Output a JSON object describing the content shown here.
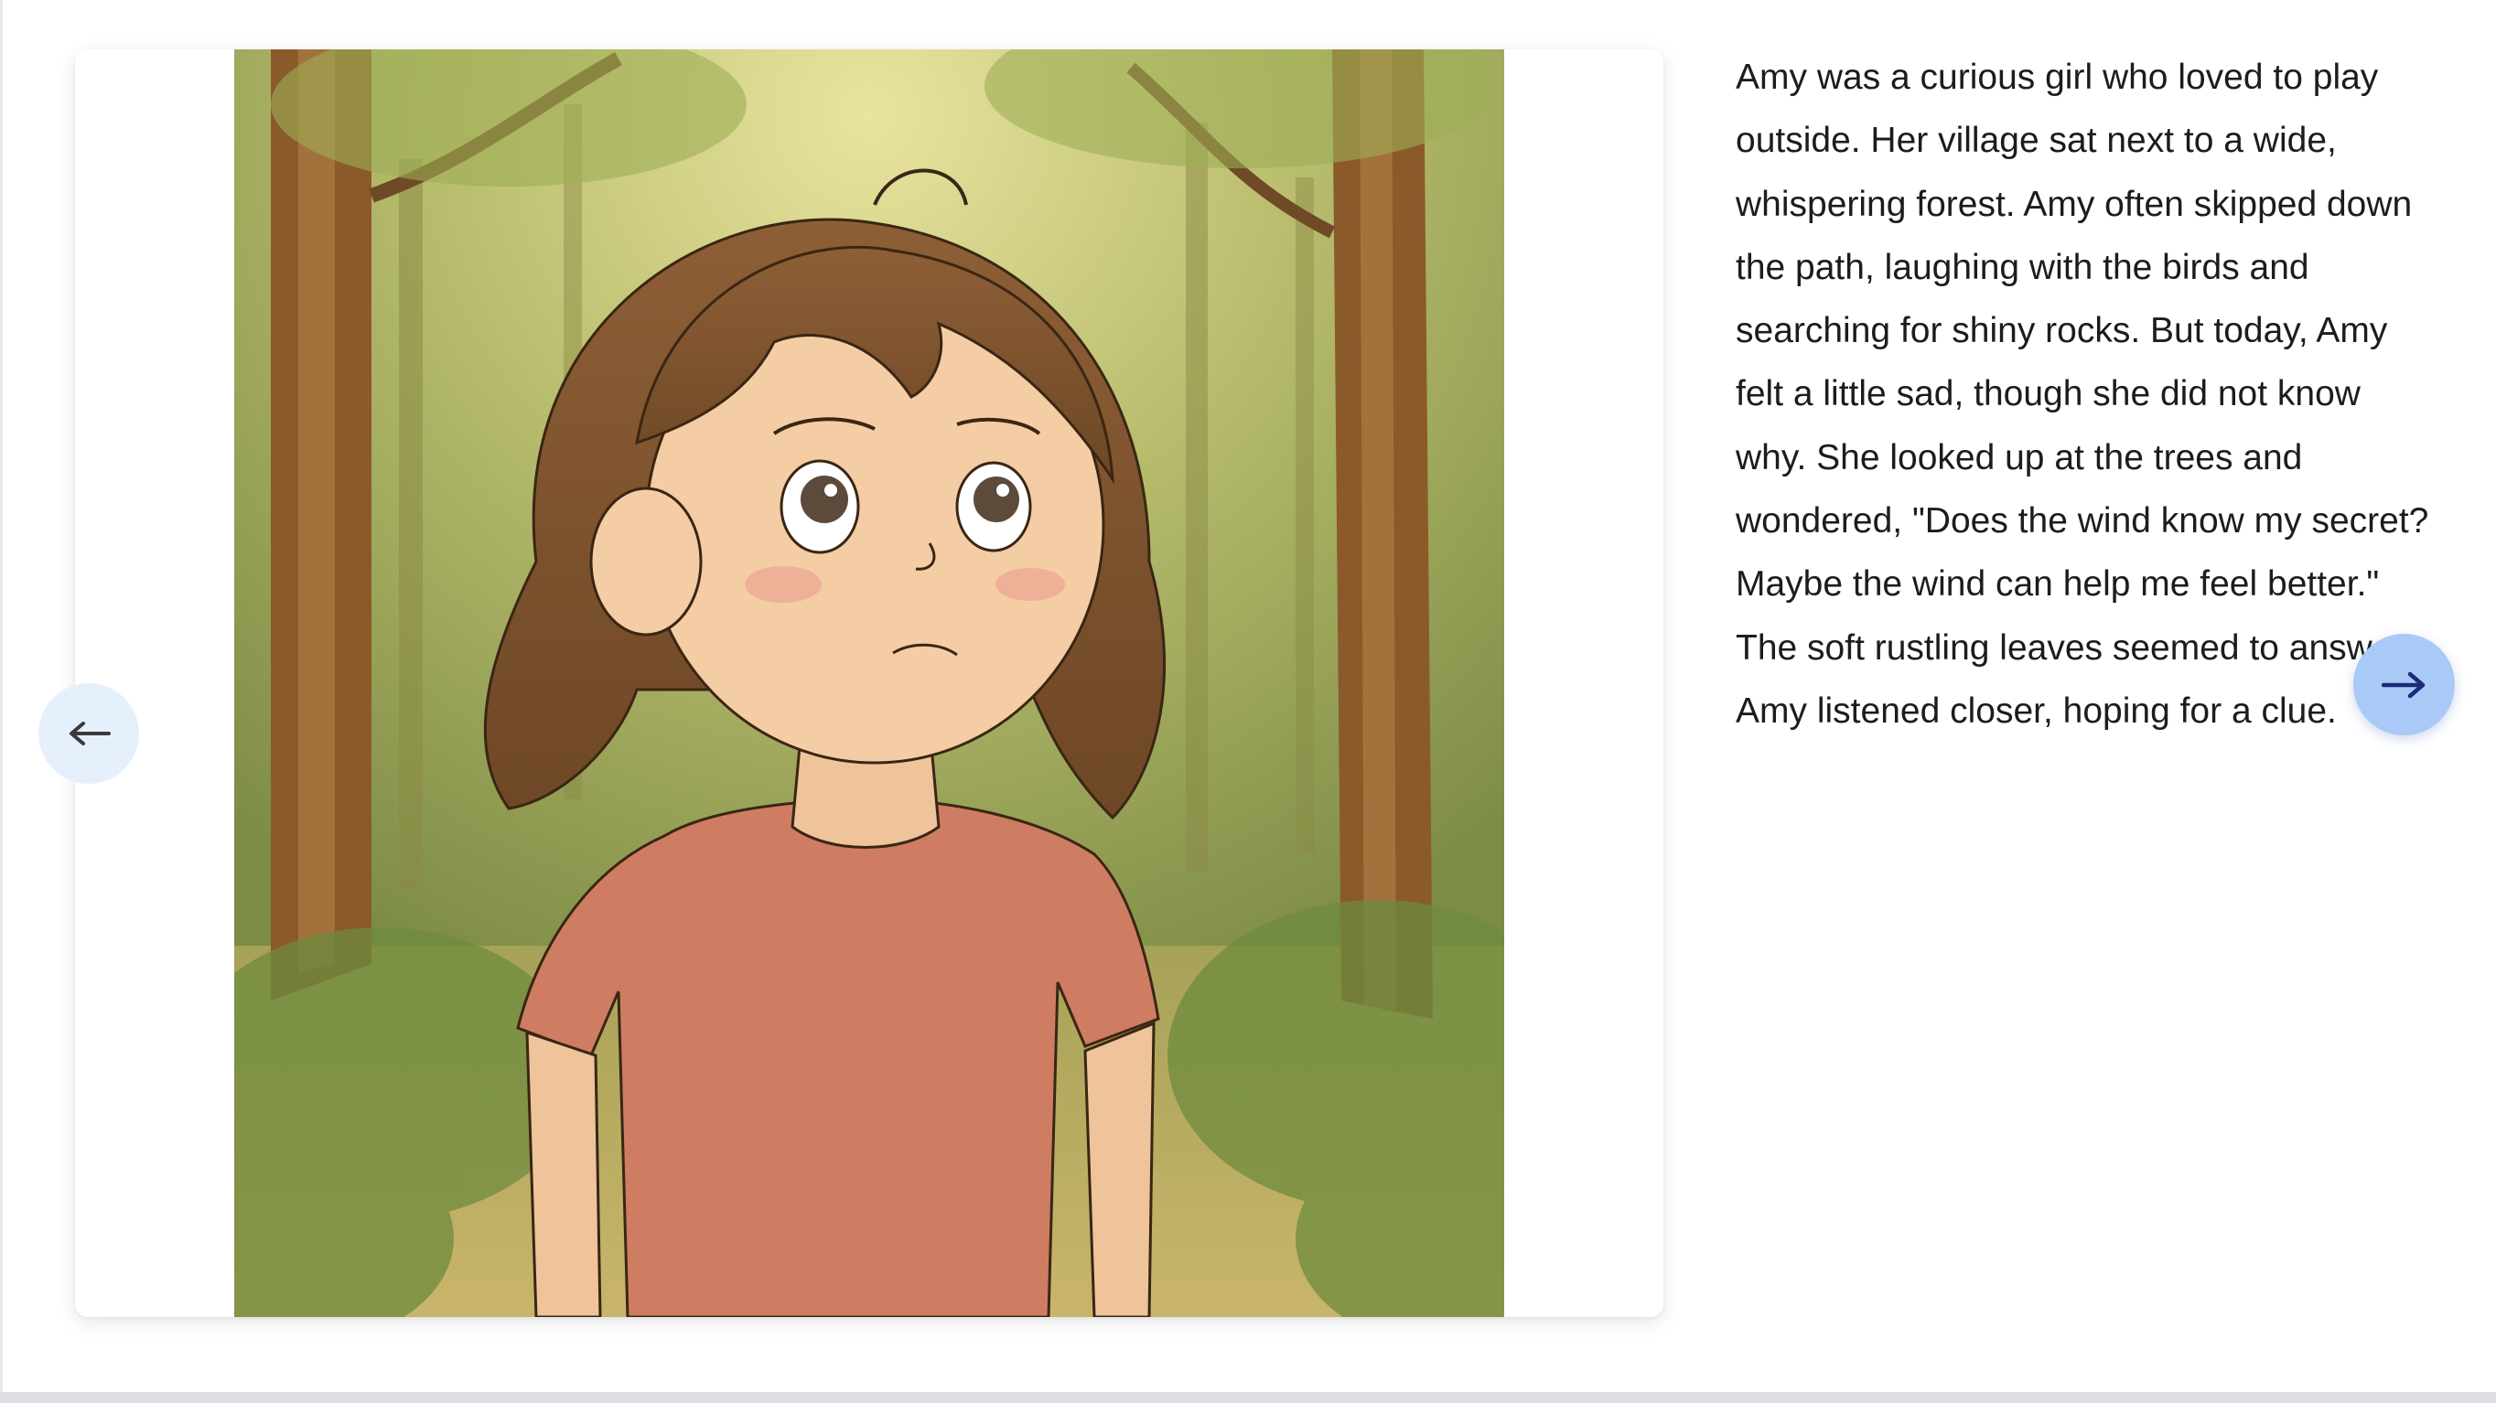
{
  "story": {
    "paragraph": "Amy was a curious girl who loved to play outside. Her village sat next to a wide, whispering forest. Amy often skipped down the path, laughing with the birds and searching for shiny rocks. But today, Amy felt a little sad, though she did not know why. She looked up at the trees and wondered, \"Does the wind know my secret? Maybe the wind can help me feel better.\" The soft rustling leaves seemed to answer. Amy listened closer, hoping for a clue."
  },
  "navigation": {
    "previous_icon": "arrow-left-icon",
    "next_icon": "arrow-right-icon"
  },
  "colors": {
    "prev_button_bg": "#e6f0fc",
    "next_button_bg": "#a9c9f7",
    "prev_arrow": "#3a3a3c",
    "next_arrow": "#1b2a7a"
  }
}
